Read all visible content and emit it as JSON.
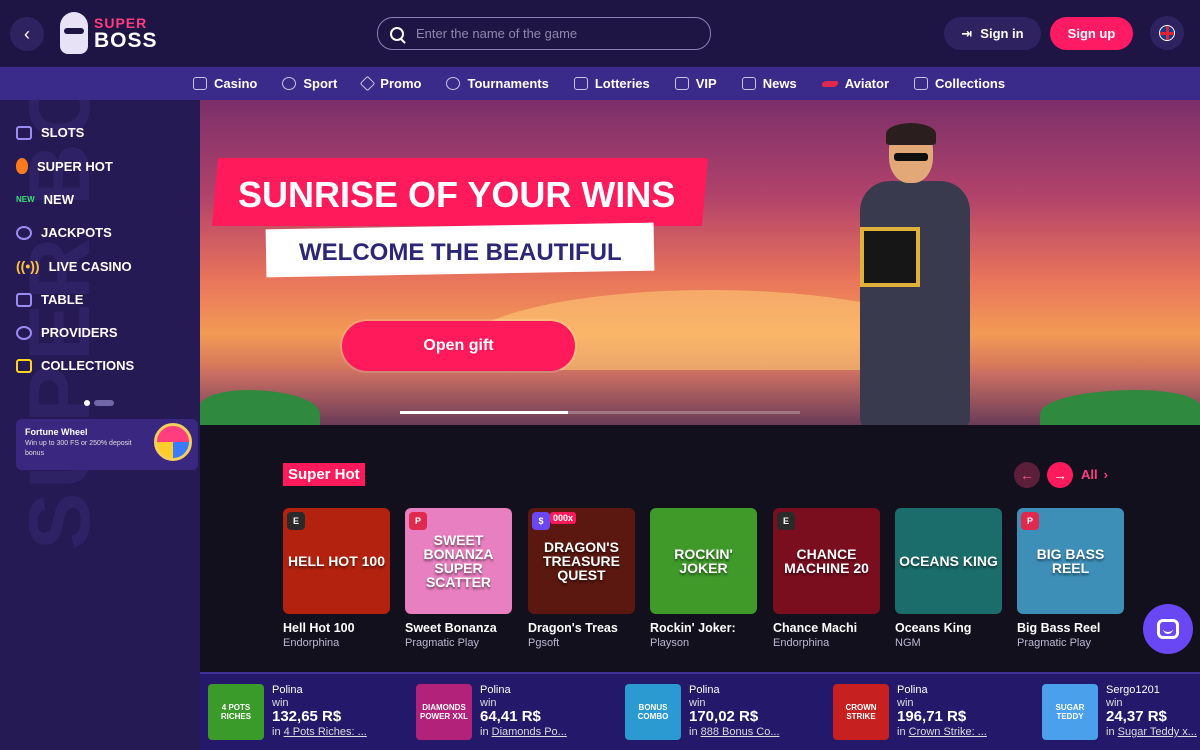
{
  "header": {
    "logo_top": "SUPER",
    "logo_bottom": "BOSS",
    "search_placeholder": "Enter the name of the game",
    "signin": "Sign in",
    "signup": "Sign up",
    "icons": [
      "back-arrow-icon",
      "search-icon",
      "signin-icon",
      "uk-flag-icon"
    ]
  },
  "nav": [
    {
      "label": "Casino",
      "icon": "casino-icon"
    },
    {
      "label": "Sport",
      "icon": "sport-icon"
    },
    {
      "label": "Promo",
      "icon": "diamond-icon"
    },
    {
      "label": "Tournaments",
      "icon": "trophy-icon"
    },
    {
      "label": "Lotteries",
      "icon": "lottery-icon"
    },
    {
      "label": "VIP",
      "icon": "crown-icon"
    },
    {
      "label": "News",
      "icon": "news-icon"
    },
    {
      "label": "Aviator",
      "icon": "plane-icon"
    },
    {
      "label": "Collections",
      "icon": "collections-icon"
    }
  ],
  "sidebar": {
    "items": [
      {
        "label": "SLOTS",
        "icon": "slots-icon"
      },
      {
        "label": "SUPER HOT",
        "icon": "flame-icon"
      },
      {
        "label": "NEW",
        "icon": "new-icon",
        "icon_text": "NEW"
      },
      {
        "label": "JACKPOTS",
        "icon": "jackpot-icon"
      },
      {
        "label": "LIVE CASINO",
        "icon": "live-icon",
        "icon_text": "((•))"
      },
      {
        "label": "TABLE",
        "icon": "dice-icon"
      },
      {
        "label": "PROVIDERS",
        "icon": "gear-icon"
      },
      {
        "label": "COLLECTIONS",
        "icon": "collections-icon"
      }
    ],
    "promo_title": "Fortune Wheel",
    "promo_desc": "Win up to 300 FS or 250% deposit bonus",
    "deco_text": "SUPER BOSS"
  },
  "banner": {
    "headline": "SUNRISE OF YOUR WINS",
    "subheadline": "WELCOME THE BEAUTIFUL",
    "cta": "Open gift",
    "progress": 0.42
  },
  "section": {
    "title": "Super Hot",
    "all_label": "All",
    "prev_icon": "←",
    "next_icon": "→",
    "games": [
      {
        "name": "Hell Hot 100",
        "provider": "Endorphina",
        "thumb_text": "HELL HOT 100",
        "bg": "#b2220e",
        "badge": "E",
        "badge_color": "#2a2a2a"
      },
      {
        "name": "Sweet Bonanza",
        "provider": "Pragmatic Play",
        "thumb_text": "SWEET BONANZA SUPER SCATTER",
        "bg": "#e77fc0",
        "badge": "P",
        "badge_color": "#e0294e"
      },
      {
        "name": "Dragon's Treas",
        "provider": "Pgsoft",
        "thumb_text": "DRAGON'S TREASURE QUEST",
        "bg": "#5a1810",
        "badge": "$",
        "badge_color": "#6a47f5",
        "badge_extra": "000x"
      },
      {
        "name": "Rockin' Joker:",
        "provider": "Playson",
        "thumb_text": "ROCKIN' JOKER",
        "bg": "#3f9a2a",
        "badge": "",
        "badge_color": ""
      },
      {
        "name": "Chance Machi",
        "provider": "Endorphina",
        "thumb_text": "CHANCE MACHINE 20",
        "bg": "#7a0e1f",
        "badge": "E",
        "badge_color": "#2a2a2a"
      },
      {
        "name": "Oceans King",
        "provider": "NGM",
        "thumb_text": "OCEANS KING",
        "bg": "#1a6d6b",
        "badge": "",
        "badge_color": ""
      },
      {
        "name": "Big Bass Reel",
        "provider": "Pragmatic Play",
        "thumb_text": "BIG BASS REEL",
        "bg": "#3d8fb8",
        "badge": "P",
        "badge_color": "#e0294e"
      }
    ]
  },
  "ticker": [
    {
      "user": "Polina",
      "label": "win",
      "amount": "132,65 R$",
      "prefix": "in",
      "game": "4 Pots Riches: ...",
      "thumb_text": "4 POTS RICHES",
      "bg": "#3a9a2a"
    },
    {
      "user": "Polina",
      "label": "win",
      "amount": "64,41 R$",
      "prefix": "in",
      "game": "Diamonds Po...",
      "thumb_text": "DIAMONDS POWER XXL",
      "bg": "#b2227a"
    },
    {
      "user": "Polina",
      "label": "win",
      "amount": "170,02 R$",
      "prefix": "in",
      "game": "888 Bonus Co...",
      "thumb_text": "BONUS COMBO",
      "bg": "#2a9ad0"
    },
    {
      "user": "Polina",
      "label": "win",
      "amount": "196,71 R$",
      "prefix": "in",
      "game": "Crown Strike: ...",
      "thumb_text": "CROWN STRIKE",
      "bg": "#c62020"
    },
    {
      "user": "Sergo1201",
      "label": "win",
      "amount": "24,37 R$",
      "prefix": "in",
      "game": "Sugar Teddy x...",
      "thumb_text": "SUGAR TEDDY",
      "bg": "#4aa0ea"
    }
  ],
  "chat_icon": "chat-icon"
}
